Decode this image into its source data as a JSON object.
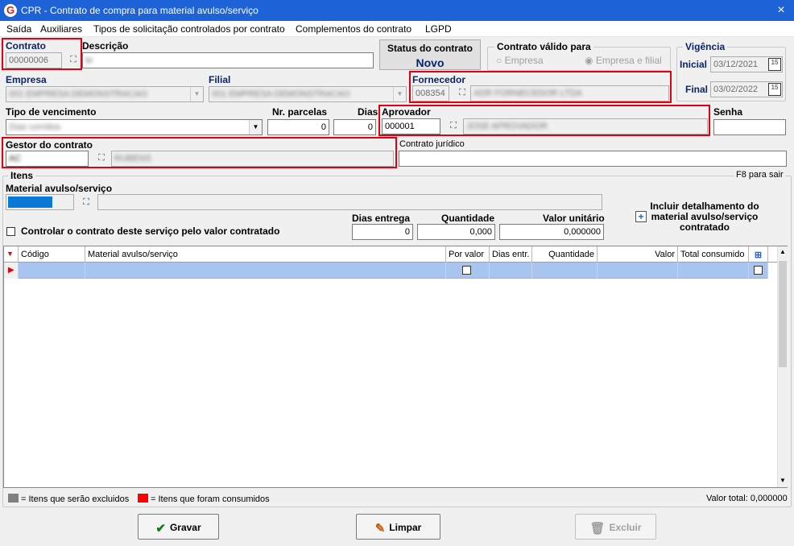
{
  "window": {
    "title": "CPR - Contrato de compra para material avulso/serviço",
    "close_icon": "×"
  },
  "menu": [
    "Saída",
    "Auxiliares",
    "Tipos de solicitação controlados por contrato",
    "Complementos do contrato",
    "LGPD"
  ],
  "contrato": {
    "label": "Contrato",
    "value": "00000006"
  },
  "descricao": {
    "label": "Descrição",
    "value": "te"
  },
  "status": {
    "label": "Status do contrato",
    "value": "Novo"
  },
  "valido": {
    "label": "Contrato válido para",
    "opt1": "Empresa",
    "opt2": "Empresa e filial",
    "selected": "Empresa e filial"
  },
  "vigencia": {
    "label": "Vigência",
    "inicial_label": "Inicial",
    "inicial": "03/12/2021",
    "final_label": "Final",
    "final": "03/02/2022",
    "cal_icon": "15"
  },
  "empresa": {
    "label": "Empresa",
    "value": "001 EMPRESA DEMONSTRACAO"
  },
  "filial": {
    "label": "Filial",
    "value": "001 EMPRESA DEMONSTRACAO"
  },
  "fornecedor": {
    "label": "Fornecedor",
    "code": "008354",
    "name": "ADR FORNECEDOR LTDA"
  },
  "vencimento": {
    "label": "Tipo de vencimento",
    "value": "Dias corridos"
  },
  "parcelas": {
    "label": "Nr. parcelas",
    "value": "0"
  },
  "dias": {
    "label": "Dias",
    "value": "0"
  },
  "aprovador": {
    "label": "Aprovador",
    "code": "000001",
    "name": "JOSE APROVADOR"
  },
  "senha": {
    "label": "Senha",
    "value": ""
  },
  "gestor": {
    "label": "Gestor do contrato",
    "code": "AC",
    "name": "RUBENS"
  },
  "juridico": {
    "label": "Contrato jurídico",
    "value": ""
  },
  "itens": {
    "label": "Itens",
    "hint": "F8 para sair",
    "material_label": "Material avulso/serviço",
    "controlar_label": "Controlar o contrato deste serviço pelo valor contratado",
    "dias_entrega_label": "Dias entrega",
    "dias_entrega": "0",
    "quantidade_label": "Quantidade",
    "quantidade": "0,000",
    "valor_unitario_label": "Valor unitário",
    "valor_unitario": "0,000000",
    "incluir_label": "Incluir detalhamento do material avulso/serviço contratado"
  },
  "grid": {
    "columns": [
      "Código",
      "Material avulso/serviço",
      "Por valor",
      "Dias entr.",
      "Quantidade",
      "Valor",
      "Total consumido"
    ]
  },
  "legend": {
    "excluidos": "= Itens que serão excluidos",
    "consumidos": "= Itens que foram consumidos",
    "excluidos_color": "#808080",
    "consumidos_color": "#ff0000",
    "total": "Valor total: 0,000000"
  },
  "buttons": {
    "gravar": "Gravar",
    "limpar": "Limpar",
    "excluir": "Excluir"
  },
  "colors": {
    "titlebar": "#1e62d7",
    "label_blue": "#0a246a",
    "highlight": "#e1000f",
    "row_selected": "#a9c4ef"
  }
}
